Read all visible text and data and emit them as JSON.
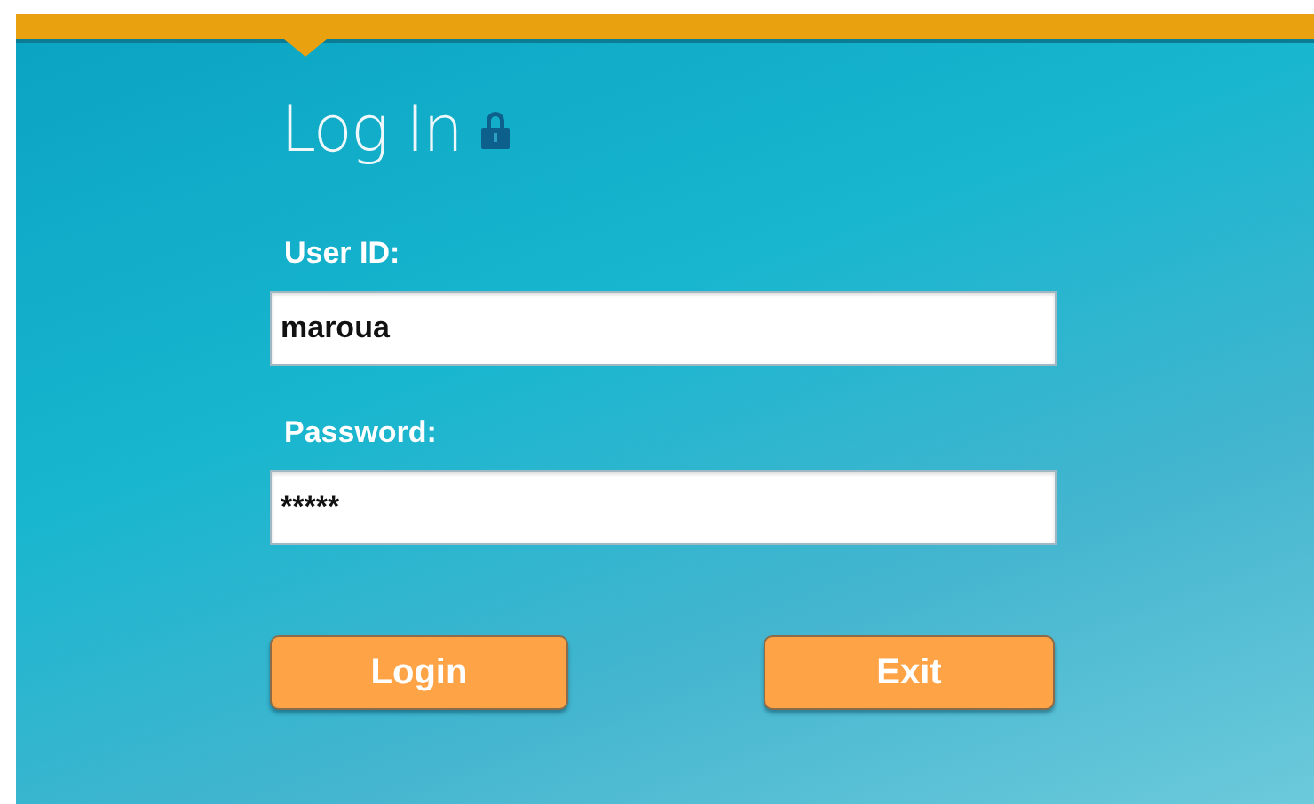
{
  "title": "Log In",
  "fields": [
    {
      "label": "User ID:",
      "value": "maroua"
    },
    {
      "label": "Password:",
      "value": "*****"
    }
  ],
  "buttons": [
    {
      "label": "Login"
    },
    {
      "label": "Exit"
    }
  ]
}
